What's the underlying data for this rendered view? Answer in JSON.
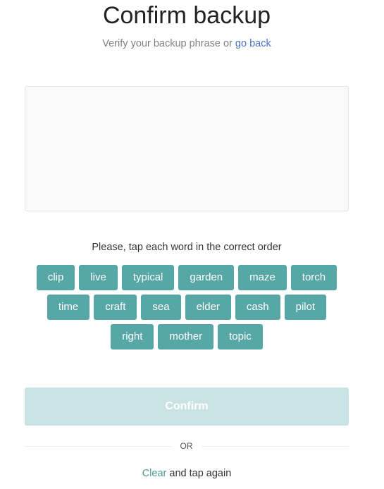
{
  "header": {
    "title": "Confirm backup",
    "subtitle_prefix": "Verify your backup phrase or ",
    "go_back_link": "go back"
  },
  "phrase_box": {
    "selected_words": []
  },
  "instruction": "Please, tap each word in the correct order",
  "word_rows": [
    [
      "clip",
      "live",
      "typical",
      "garden",
      "maze",
      "torch"
    ],
    [
      "time",
      "craft",
      "sea",
      "elder",
      "cash",
      "pilot"
    ],
    [
      "right",
      "mother",
      "topic"
    ]
  ],
  "confirm_button": {
    "label": "Confirm",
    "enabled": false
  },
  "divider": {
    "label": "OR"
  },
  "footer": {
    "clear_link": "Clear",
    "suffix": " and tap again"
  },
  "colors": {
    "word_chip": "#57a7a7",
    "confirm_disabled": "#c9e3e5",
    "link_blue": "#4a73c4",
    "link_teal": "#4c9a9a"
  }
}
